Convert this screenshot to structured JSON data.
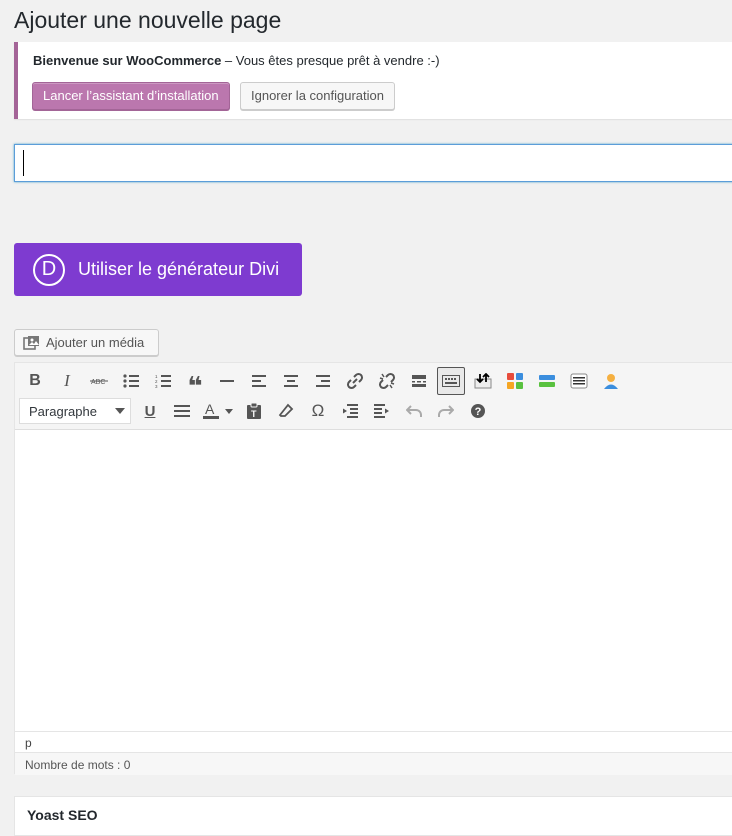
{
  "page": {
    "title": "Ajouter une nouvelle page"
  },
  "notice": {
    "strong": "Bienvenue sur WooCommerce",
    "text": " – Vous êtes presque prêt à vendre :-)",
    "primary_button": "Lancer l’assistant d’installation",
    "secondary_button": "Ignorer la configuration",
    "accent_color": "#a46497"
  },
  "title_input": {
    "value": "",
    "placeholder": ""
  },
  "divi": {
    "logo_letter": "D",
    "label": "Utiliser le générateur Divi",
    "color": "#7e3bd0"
  },
  "media": {
    "label": "Ajouter un média"
  },
  "toolbar": {
    "format_select": "Paragraphe",
    "row1": [
      "bold-icon",
      "italic-icon",
      "strikethrough-icon",
      "bullet-list-icon",
      "numbered-list-icon",
      "blockquote-icon",
      "horizontal-rule-icon",
      "align-left-icon",
      "align-center-icon",
      "align-right-icon",
      "link-icon",
      "unlink-icon",
      "read-more-icon",
      "toolbar-toggle-icon",
      "plugin-arrows-icon",
      "plugin-grid-icon",
      "plugin-layers-icon",
      "plugin-list-icon",
      "plugin-user-icon"
    ],
    "row2": [
      "underline-icon",
      "justify-icon",
      "text-color-icon",
      "paste-text-icon",
      "clear-formatting-icon",
      "special-char-icon",
      "outdent-icon",
      "indent-icon",
      "undo-icon",
      "redo-icon",
      "help-icon"
    ]
  },
  "editor": {
    "path": "p",
    "word_count": "Nombre de mots : 0"
  },
  "yoast": {
    "title": "Yoast SEO"
  }
}
